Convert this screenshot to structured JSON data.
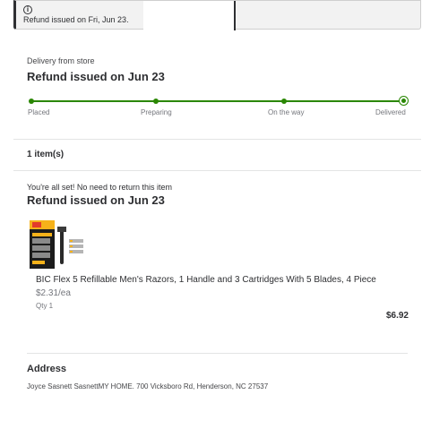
{
  "banner": {
    "icon": "info-icon",
    "message": "Refund issued on Fri, Jun 23."
  },
  "delivery": {
    "subtitle": "Delivery from store",
    "title": "Refund issued on Jun 23",
    "steps": [
      "Placed",
      "Preparing",
      "On the way",
      "Delivered"
    ],
    "accent_color": "#2a8703"
  },
  "items": {
    "count_label": "1 item(s)",
    "note": "You're all set! No need to return this item",
    "title": "Refund issued on Jun 23",
    "product": {
      "name": "BIC Flex 5 Refillable Men's Razors, 1 Handle and 3 Cartridges With 5 Blades, 4 Piece",
      "unit_price": "$2.31/ea",
      "qty": "Qty 1",
      "total": "$6.92"
    }
  },
  "address": {
    "title": "Address",
    "line": "Joyce Sasnett SasnettMY HOME. 700 Vicksboro Rd, Henderson, NC 27537"
  }
}
